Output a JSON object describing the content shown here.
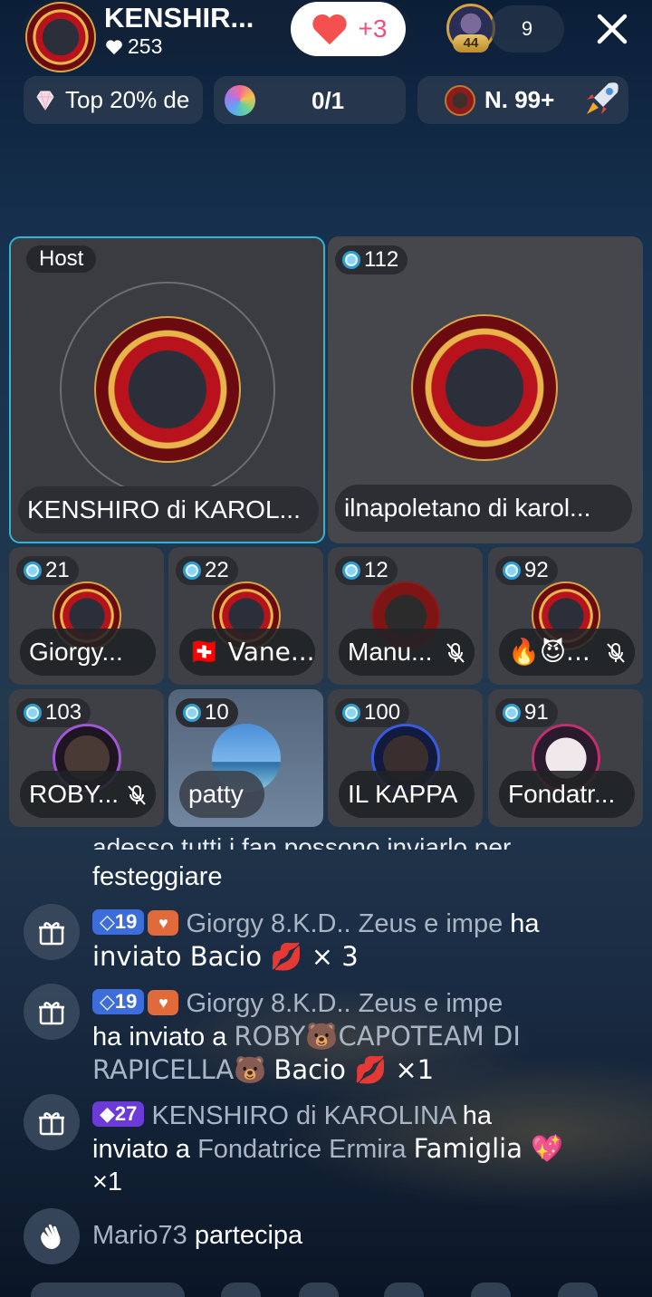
{
  "header": {
    "host_name": "KENSHIR...",
    "host_likes": "253",
    "like_increment": "+3",
    "viewer_level": "44",
    "viewer_count": "9"
  },
  "chips": {
    "top_rank": "Top 20% de",
    "goal_progress": "0/1",
    "room_rank": "N. 99+"
  },
  "seats": {
    "host": {
      "tag": "Host",
      "name": "KENSHIRO di KAROL..."
    },
    "co": {
      "level": "112",
      "name": "ilnapoletano di karol..."
    },
    "row1": [
      {
        "level": "21",
        "name": "Giorgy...",
        "muted": false
      },
      {
        "level": "22",
        "name": "🇨🇭 Vane...",
        "muted": false
      },
      {
        "level": "12",
        "name": "Manu...",
        "muted": true
      },
      {
        "level": "92",
        "name": "🔥😈...",
        "muted": true
      }
    ],
    "row2": [
      {
        "level": "103",
        "name": "ROBY...",
        "muted": true
      },
      {
        "level": "10",
        "name": "patty",
        "muted": false
      },
      {
        "level": "100",
        "name": "IL KAPPA",
        "muted": false
      },
      {
        "level": "91",
        "name": "Fondatr...",
        "muted": false
      }
    ]
  },
  "chat": {
    "partial_line1": "adesso tutti i fan possono inviarlo per",
    "partial_line2": "festeggiare",
    "msg1": {
      "level": "19",
      "sender": "Giorgy  8.K.D.. Zeus e impe",
      "action": "ha",
      "line2": "inviato Bacio 💋 × 3"
    },
    "msg2": {
      "level": "19",
      "sender": "Giorgy  8.K.D.. Zeus e impe",
      "action": "ha inviato a",
      "target1": "ROBY🐻CAPOTEAM DI",
      "target2": "RAPICELLA🐻",
      "gift": "Bacio 💋 ×1"
    },
    "msg3": {
      "level": "27",
      "sender": "KENSHIRO di KAROLINA",
      "action": "ha",
      "line2a": "inviato a",
      "target": "Fondatrice Ermira",
      "gift": "Famiglia 💖",
      "line3": "×1"
    },
    "msg4": {
      "user": "Mario73",
      "action": "partecipa"
    }
  }
}
